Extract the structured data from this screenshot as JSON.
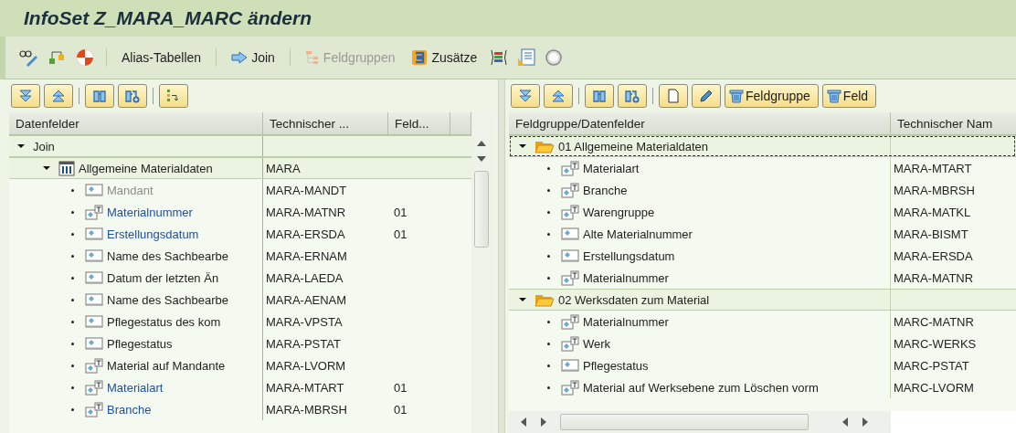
{
  "window": {
    "title": "InfoSet Z_MARA_MARC ändern"
  },
  "toolbar": {
    "buttons": [
      {
        "label": "Alias-Tabellen",
        "kind": "plain",
        "disabled": false
      },
      {
        "label": "Join",
        "kind": "arrow",
        "disabled": false
      },
      {
        "label": "Feldgruppen",
        "kind": "tree",
        "disabled": true
      },
      {
        "label": "Zusätze",
        "kind": "extras",
        "disabled": false
      }
    ]
  },
  "right_toolbar": {
    "buttons": [
      {
        "label": "Feldgruppe",
        "kind": "delete"
      },
      {
        "label": "Feld",
        "kind": "delete"
      }
    ]
  },
  "left_tree": {
    "columns": [
      "Datenfelder",
      "Technischer ...",
      "Feld..."
    ],
    "rows": [
      {
        "label": "Join",
        "expanded": true,
        "children": [
          {
            "label": "Allgemeine Materialdaten",
            "technical_name": "MARA",
            "kind": "table",
            "expanded": true,
            "children": [
              {
                "label": "Mandant",
                "technical_name": "MARA-MANDT",
                "kind": "field",
                "assigned": false,
                "disabled": true
              },
              {
                "label": "Materialnummer",
                "technical_name": "MARA-MATNR",
                "field_group": "01",
                "kind": "text-field",
                "assigned": true,
                "disabled": false
              },
              {
                "label": "Erstellungsdatum",
                "technical_name": "MARA-ERSDA",
                "field_group": "01",
                "kind": "field",
                "assigned": true,
                "disabled": false
              },
              {
                "label": "Name des Sachbearbe",
                "technical_name": "MARA-ERNAM",
                "kind": "field",
                "assigned": false,
                "disabled": false
              },
              {
                "label": "Datum der letzten Än",
                "technical_name": "MARA-LAEDA",
                "kind": "field",
                "assigned": false,
                "disabled": false
              },
              {
                "label": "Name des Sachbearbe",
                "technical_name": "MARA-AENAM",
                "kind": "field",
                "assigned": false,
                "disabled": false
              },
              {
                "label": "Pflegestatus des kom",
                "technical_name": "MARA-VPSTA",
                "kind": "field",
                "assigned": false,
                "disabled": false
              },
              {
                "label": "Pflegestatus",
                "technical_name": "MARA-PSTAT",
                "kind": "field",
                "assigned": false,
                "disabled": false
              },
              {
                "label": "Material auf Mandante",
                "technical_name": "MARA-LVORM",
                "kind": "text-field",
                "assigned": false,
                "disabled": false
              },
              {
                "label": "Materialart",
                "technical_name": "MARA-MTART",
                "field_group": "01",
                "kind": "text-field",
                "assigned": true,
                "disabled": false
              },
              {
                "label": "Branche",
                "technical_name": "MARA-MBRSH",
                "field_group": "01",
                "kind": "text-field",
                "assigned": true,
                "disabled": false
              }
            ]
          }
        ]
      }
    ]
  },
  "right_tree": {
    "columns": [
      "Feldgruppe/Datenfelder",
      "Technischer Nam"
    ],
    "rows": [
      {
        "label": "01 Allgemeine Materialdaten",
        "kind": "group",
        "expanded": true,
        "selected": true,
        "children": [
          {
            "label": "Materialart",
            "technical_name": "MARA-MTART",
            "kind": "text-field"
          },
          {
            "label": "Branche",
            "technical_name": "MARA-MBRSH",
            "kind": "text-field"
          },
          {
            "label": "Warengruppe",
            "technical_name": "MARA-MATKL",
            "kind": "text-field"
          },
          {
            "label": "Alte Materialnummer",
            "technical_name": "MARA-BISMT",
            "kind": "field"
          },
          {
            "label": "Erstellungsdatum",
            "technical_name": "MARA-ERSDA",
            "kind": "field"
          },
          {
            "label": "Materialnummer",
            "technical_name": "MARA-MATNR",
            "kind": "text-field"
          }
        ]
      },
      {
        "label": "02 Werksdaten zum Material",
        "kind": "group",
        "expanded": true,
        "selected": false,
        "children": [
          {
            "label": "Materialnummer",
            "technical_name": "MARC-MATNR",
            "kind": "text-field"
          },
          {
            "label": "Werk",
            "technical_name": "MARC-WERKS",
            "kind": "text-field"
          },
          {
            "label": "Pflegestatus",
            "technical_name": "MARC-PSTAT",
            "kind": "field"
          },
          {
            "label": "Material auf Werksebene zum Löschen vorm",
            "technical_name": "MARC-LVORM",
            "kind": "text-field"
          }
        ]
      }
    ]
  }
}
